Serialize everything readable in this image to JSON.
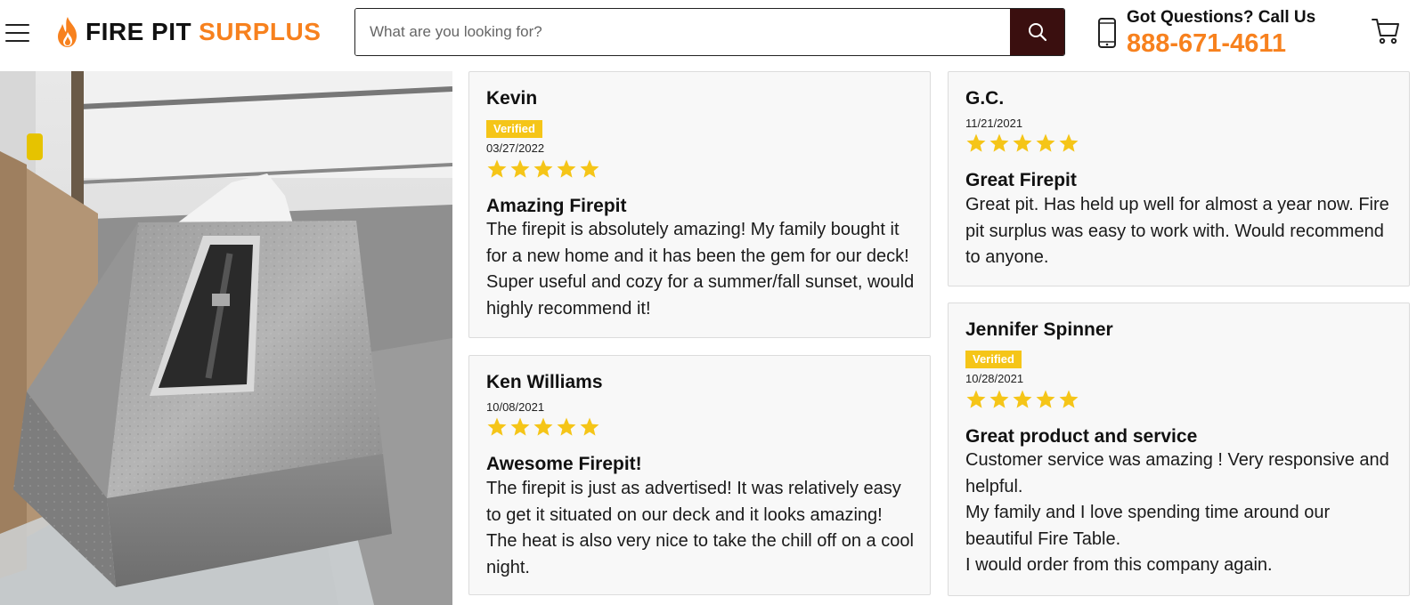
{
  "header": {
    "logo_word1": "FIRE PIT",
    "logo_word2": "SURPLUS",
    "search_placeholder": "What are you looking for?",
    "phone_prompt": "Got Questions? Call Us",
    "phone_number": "888-671-4611"
  },
  "colors": {
    "brand_orange": "#f7811e",
    "search_button": "#3a0f0f",
    "star_yellow": "#f5c518",
    "verified_badge": "#f5c518"
  },
  "icons": [
    "menu-icon",
    "flame-icon",
    "search-icon",
    "phone-icon",
    "cart-icon",
    "star-icon"
  ],
  "reviews": [
    {
      "name": "Kevin",
      "verified": "Verified",
      "date": "03/27/2022",
      "rating": 5,
      "title": "Amazing Firepit",
      "body": [
        "The firepit is absolutely amazing! My family bought it for a new home and it has been the gem for our deck! Super useful and cozy for a summer/fall sunset, would highly recommend it!"
      ]
    },
    {
      "name": "Ken Williams",
      "date": "10/08/2021",
      "rating": 5,
      "title": "Awesome Firepit!",
      "body": [
        "The firepit is just as advertised! It was relatively easy to get it situated on our deck and it looks amazing! The heat is also very nice to take the chill off on a cool night."
      ]
    },
    {
      "name": "G.C.",
      "date": "11/21/2021",
      "rating": 5,
      "title": "Great Firepit",
      "body": [
        "Great pit. Has held up well for almost a year now. Fire pit surplus was easy to work with. Would recommend to anyone."
      ]
    },
    {
      "name": "Jennifer Spinner",
      "verified": "Verified",
      "date": "10/28/2021",
      "rating": 5,
      "title": "Great product and service",
      "body": [
        "Customer service was amazing ! Very responsive and helpful.",
        "My family and I love spending time around our beautiful Fire Table.",
        "I would order from this company again."
      ]
    }
  ]
}
